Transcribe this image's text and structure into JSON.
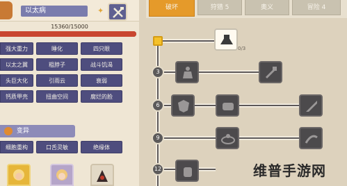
{
  "character": {
    "name": "以太病",
    "hp_text": "15360/15000",
    "hp_fraction": 1.0
  },
  "skills_a": [
    "强大重力",
    "睡化",
    "四只眼",
    "以太之翼",
    "粗脖子",
    "战斗饥渴",
    "头巨大化",
    "引雨云",
    "衰弱",
    "钙质甲壳",
    "扭曲空间",
    "腐烂的脸"
  ],
  "mutation": {
    "title": "变异"
  },
  "skills_b": [
    "细胞重构",
    "口舌灵敏",
    "绝缘体"
  ],
  "tabs": [
    {
      "label": "破坏",
      "active": true
    },
    {
      "label": "狩猎 5",
      "active": false
    },
    {
      "label": "奥义",
      "active": false
    },
    {
      "label": "冒险 4",
      "active": false
    }
  ],
  "tree": {
    "levels": [
      "3",
      "6",
      "9",
      "12"
    ],
    "root_counter": "0/3"
  },
  "watermark": "维普手游网",
  "colors": {
    "accent_orange": "#e59a2a",
    "skill_bg": "#4e4d7e",
    "hp_red": "#c9462f",
    "start_node": "#f5c12a"
  }
}
